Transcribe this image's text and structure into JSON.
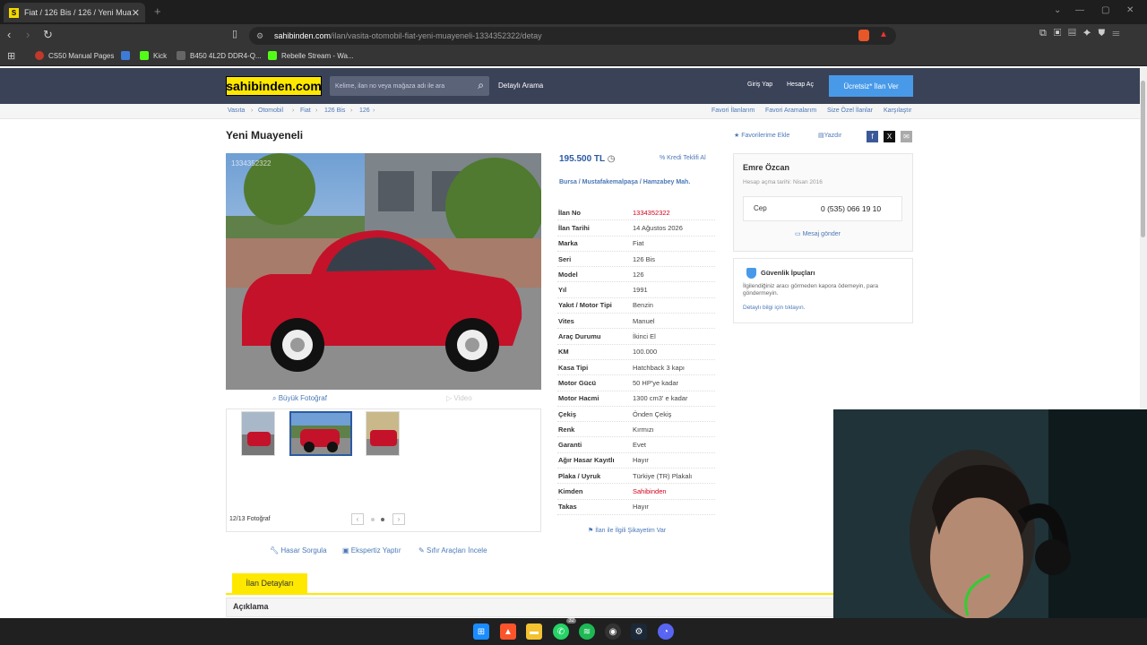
{
  "browser": {
    "tab_title": "Fiat / 126 Bis / 126 / Yeni Muaye",
    "url_domain": "sahibinden.com",
    "url_path": "/ilan/vasita-otomobil-fiat-yeni-muayeneli-1334352322/detay",
    "bookmarks": [
      {
        "label": "CS50 Manual Pages",
        "color": "#c0392b"
      },
      {
        "label": "",
        "color": "#3e7bd8"
      },
      {
        "label": "Kick",
        "color": "#53fc18"
      },
      {
        "label": "B450 4L2D DDR4-Q...",
        "color": "#666"
      },
      {
        "label": "Rebelle Stream - Wa...",
        "color": "#53fc18"
      }
    ]
  },
  "site": {
    "logo": "sahibinden.com",
    "search_placeholder": "Kelime, ilan no veya mağaza adı ile ara",
    "detailed_search": "Detaylı Arama",
    "login": "Giriş Yap",
    "register": "Hesap Aç",
    "post_ad": "Ücretsiz* İlan Ver"
  },
  "breadcrumb": [
    "Vasıta",
    "Otomobil",
    "Fiat",
    "126 Bis",
    "126"
  ],
  "top_links": [
    "Favori İlanlarım",
    "Favori Aramalarım",
    "Size Özel İlanlar",
    "Karşılaştır"
  ],
  "listing": {
    "title": "Yeni Muayeneli",
    "add_favorites": "Favorilerime Ekle",
    "print": "Yazdır",
    "photo_watermark": "1334352322",
    "big_photo": "Büyük Fotoğraf",
    "video": "Video",
    "photo_count": "12/13 Fotoğraf",
    "bottom_links": [
      "Hasar Sorgula",
      "Ekspertiz Yaptır",
      "Sıfır Araçları İncele"
    ],
    "price": "195.500 TL",
    "credit": "Kredi Teklifi Al",
    "location": "Bursa  /  Mustafakemalpaşa  /  Hamzabey Mah.",
    "details": [
      {
        "k": "İlan No",
        "v": "1334352322",
        "red": true
      },
      {
        "k": "İlan Tarihi",
        "v": "14 Ağustos 2026"
      },
      {
        "k": "Marka",
        "v": "Fiat"
      },
      {
        "k": "Seri",
        "v": "126 Bis"
      },
      {
        "k": "Model",
        "v": "126"
      },
      {
        "k": "Yıl",
        "v": "1991"
      },
      {
        "k": "Yakıt / Motor Tipi",
        "v": "Benzin"
      },
      {
        "k": "Vites",
        "v": "Manuel"
      },
      {
        "k": "Araç Durumu",
        "v": "İkinci El"
      },
      {
        "k": "KM",
        "v": "100.000"
      },
      {
        "k": "Kasa Tipi",
        "v": "Hatchback 3 kapı"
      },
      {
        "k": "Motor Gücü",
        "v": "50 HP'ye kadar"
      },
      {
        "k": "Motor Hacmi",
        "v": "1300 cm3' e kadar"
      },
      {
        "k": "Çekiş",
        "v": "Önden Çekiş"
      },
      {
        "k": "Renk",
        "v": "Kırmızı"
      },
      {
        "k": "Garanti",
        "v": "Evet"
      },
      {
        "k": "Ağır Hasar Kayıtlı",
        "v": "Hayır"
      },
      {
        "k": "Plaka / Uyruk",
        "v": "Türkiye (TR) Plakalı"
      },
      {
        "k": "Kimden",
        "v": "Sahibinden",
        "red": true
      },
      {
        "k": "Takas",
        "v": "Hayır"
      }
    ],
    "complain": "İlan ile İlgili Şikayetim Var",
    "tab_details": "İlan Detayları",
    "description": "Açıklama"
  },
  "seller": {
    "name": "Emre Özcan",
    "since": "Hesap açma tarihi: Nisan 2016",
    "phone_label": "Cep",
    "phone": "0 (535) 066 19 10",
    "message": "Mesaj gönder"
  },
  "safety": {
    "title": "Güvenlik İpuçları",
    "text": "İlgilendiğiniz aracı görmeden kapora ödemeyin, para göndermeyin.",
    "detail": "Detaylı bilgi için tıklayın."
  },
  "taskbar": {
    "badges": [
      "32"
    ]
  }
}
